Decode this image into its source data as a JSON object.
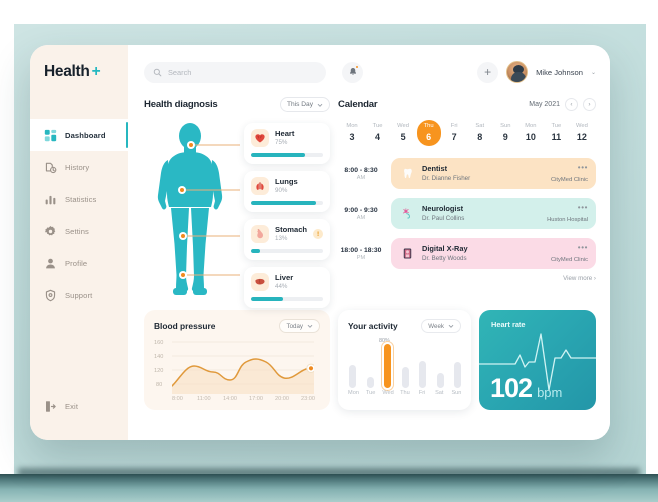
{
  "brand": {
    "name": "Health",
    "plus": "+"
  },
  "sidebar": {
    "items": [
      {
        "label": "Dashboard",
        "icon": "grid-icon"
      },
      {
        "label": "History",
        "icon": "history-icon"
      },
      {
        "label": "Statistics",
        "icon": "bar-chart-icon"
      },
      {
        "label": "Settins",
        "icon": "gear-icon"
      },
      {
        "label": "Profile",
        "icon": "user-icon"
      },
      {
        "label": "Support",
        "icon": "shield-icon"
      }
    ],
    "exit": {
      "label": "Exit",
      "icon": "logout-icon"
    }
  },
  "topbar": {
    "search_placeholder": "Search",
    "notification_icon": "bell-icon",
    "add_label": "+",
    "user_name": "Mike Johnson",
    "caret": "⌄"
  },
  "diagnosis": {
    "title": "Health diagnosis",
    "filter": "This Day",
    "organs": [
      {
        "name": "Heart",
        "percent": "75%",
        "value": 75,
        "icon": "heart-organ-icon",
        "warning": false
      },
      {
        "name": "Lungs",
        "percent": "90%",
        "value": 90,
        "icon": "lungs-organ-icon",
        "warning": false
      },
      {
        "name": "Stomach",
        "percent": "13%",
        "value": 13,
        "icon": "stomach-organ-icon",
        "warning": true,
        "warning_label": "!"
      },
      {
        "name": "Liver",
        "percent": "44%",
        "value": 44,
        "icon": "liver-organ-icon",
        "warning": false
      }
    ]
  },
  "calendar": {
    "title": "Calendar",
    "month": "May 2021",
    "prev": "‹",
    "next": "›",
    "days": [
      {
        "dow": "Mon",
        "num": "3",
        "active": false
      },
      {
        "dow": "Tue",
        "num": "4",
        "active": false
      },
      {
        "dow": "Wed",
        "num": "5",
        "active": false
      },
      {
        "dow": "Thu",
        "num": "6",
        "active": true
      },
      {
        "dow": "Fri",
        "num": "7",
        "active": false
      },
      {
        "dow": "Sat",
        "num": "8",
        "active": false
      },
      {
        "dow": "Sun",
        "num": "9",
        "active": false
      },
      {
        "dow": "Mon",
        "num": "10",
        "active": false
      },
      {
        "dow": "Tue",
        "num": "11",
        "active": false
      },
      {
        "dow": "Wed",
        "num": "12",
        "active": false
      }
    ],
    "appointments": [
      {
        "range": "8:00 - 8:30",
        "meridiem": "AM",
        "title": "Dentist",
        "doctor": "Dr. Dianne Fisher",
        "clinic": "CityMed Clinic",
        "icon": "tooth-icon",
        "color": "#fce3c4",
        "menu": "•••"
      },
      {
        "range": "9:00 - 9:30",
        "meridiem": "AM",
        "title": "Neurologist",
        "doctor": "Dr. Paul Collins",
        "clinic": "Huston Hospital",
        "icon": "brain-nerve-icon",
        "color": "#d3f0eb",
        "menu": "•••"
      },
      {
        "range": "18:00 - 18:30",
        "meridiem": "PM",
        "title": "Digital X-Ray",
        "doctor": "Dr. Betty Woods",
        "clinic": "CityMed Clinic",
        "icon": "xray-icon",
        "color": "#fbdbe6",
        "menu": "•••"
      }
    ],
    "view_more": "View more ›"
  },
  "chart_data": [
    {
      "type": "line",
      "title": "Blood pressure",
      "filter": "Today",
      "xlabel": "",
      "ylabel": "",
      "ylim": [
        70,
        165
      ],
      "yticks": [
        "160",
        "140",
        "120",
        "80"
      ],
      "ytick_values": [
        160,
        140,
        120,
        80
      ],
      "x": [
        "8:00",
        "11:00",
        "14:00",
        "17:00",
        "20:00",
        "23:00"
      ],
      "values": [
        88,
        118,
        124,
        135,
        133,
        118,
        112,
        128,
        145,
        147,
        136,
        120,
        114,
        119,
        128
      ],
      "accent": "#e59a3d",
      "grid": false,
      "area_fill": true,
      "end_marker": true
    },
    {
      "type": "bar",
      "title": "Your activity",
      "filter": "Week",
      "categories": [
        "Mon",
        "Tue",
        "Wed",
        "Thu",
        "Fri",
        "Sat",
        "Sun"
      ],
      "values": [
        52,
        26,
        100,
        48,
        62,
        34,
        58
      ],
      "highlight_index": 2,
      "highlight_label": "80%",
      "accent": "#f7941e",
      "bar_color": "#e6e8ee",
      "ylim": [
        0,
        100
      ]
    },
    {
      "type": "line",
      "title": "Heart rate",
      "value": "102",
      "unit": "bpm",
      "accent": "#ffffff",
      "background": "#2aabb2",
      "waveform": "ecg"
    }
  ]
}
